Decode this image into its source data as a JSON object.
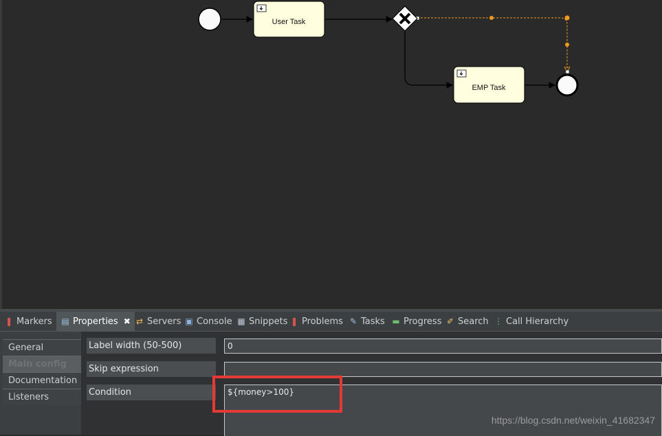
{
  "diagram": {
    "user_task_label": "User Task",
    "emp_task_label": "EMP Task",
    "selected_flow_color": "#f29a1d"
  },
  "tabs": [
    {
      "label": "Markers",
      "icon": "markers-icon"
    },
    {
      "label": "Properties",
      "icon": "properties-icon",
      "active": true,
      "close": "✖"
    },
    {
      "label": "Servers",
      "icon": "servers-icon"
    },
    {
      "label": "Console",
      "icon": "console-icon"
    },
    {
      "label": "Snippets",
      "icon": "snippets-icon"
    },
    {
      "label": "Problems",
      "icon": "problems-icon"
    },
    {
      "label": "Tasks",
      "icon": "tasks-icon"
    },
    {
      "label": "Progress",
      "icon": "progress-icon"
    },
    {
      "label": "Search",
      "icon": "search-icon"
    },
    {
      "label": "Call Hierarchy",
      "icon": "call-hierarchy-icon"
    }
  ],
  "sidebar": {
    "items": [
      {
        "label": "General"
      },
      {
        "label": "Main config"
      },
      {
        "label": "Documentation"
      },
      {
        "label": "Listeners"
      }
    ]
  },
  "properties": {
    "label_width": {
      "label": "Label width (50-500)",
      "value": "0"
    },
    "skip_expression": {
      "label": "Skip expression",
      "value": ""
    },
    "condition": {
      "label": "Condition",
      "value": "${money>100}"
    }
  },
  "watermark": "https://blog.csdn.net/weixin_41682347"
}
